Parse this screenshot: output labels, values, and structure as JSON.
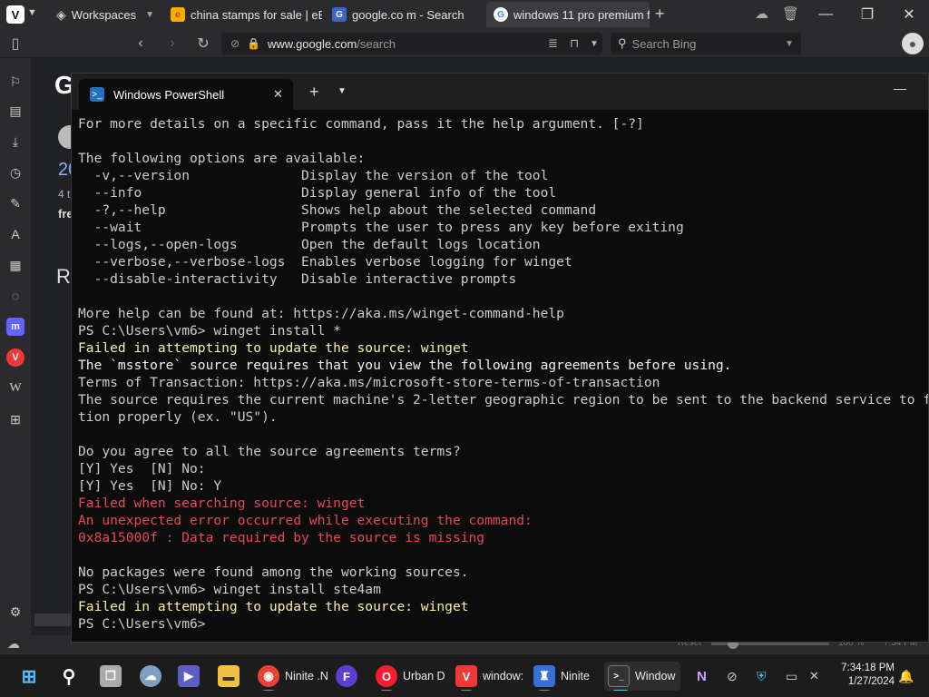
{
  "browser": {
    "workspaces_label": "Workspaces",
    "tabs": [
      {
        "label": "china stamps for sale | eBay"
      },
      {
        "label": "google.co m - Search"
      },
      {
        "label": "windows 11 pro premium fr"
      }
    ],
    "address": {
      "url_domain": "www.google.com",
      "url_path": "/search"
    },
    "search": {
      "placeholder": "Search Bing"
    }
  },
  "page_background": {
    "logo_letter": "G",
    "fragments": [
      "20",
      "4 t",
      "fre",
      "R"
    ]
  },
  "status_strip": {
    "reset_label": "Reset",
    "zoom": "100 %",
    "time": "7:34 PM"
  },
  "powershell": {
    "tab_title": "Windows PowerShell",
    "lines": [
      {
        "t": "For more details on a specific command, pass it the help argument. [-?]",
        "c": "w"
      },
      {
        "t": "",
        "c": "w"
      },
      {
        "t": "The following options are available:",
        "c": "w"
      },
      {
        "t": "  -v,--version              Display the version of the tool",
        "c": "w"
      },
      {
        "t": "  --info                    Display general info of the tool",
        "c": "w"
      },
      {
        "t": "  -?,--help                 Shows help about the selected command",
        "c": "w"
      },
      {
        "t": "  --wait                    Prompts the user to press any key before exiting",
        "c": "w"
      },
      {
        "t": "  --logs,--open-logs        Open the default logs location",
        "c": "w"
      },
      {
        "t": "  --verbose,--verbose-logs  Enables verbose logging for winget",
        "c": "w"
      },
      {
        "t": "  --disable-interactivity   Disable interactive prompts",
        "c": "w"
      },
      {
        "t": "",
        "c": "w"
      },
      {
        "t": "More help can be found at: https://aka.ms/winget-command-help",
        "c": "w"
      },
      {
        "t": "PS C:\\Users\\vm6> winget install *",
        "c": "w"
      },
      {
        "t": "Failed in attempting to update the source: winget",
        "c": "y"
      },
      {
        "t": "The `msstore` source requires that you view the following agreements before using.",
        "c": "hw"
      },
      {
        "t": "Terms of Transaction: https://aka.ms/microsoft-store-terms-of-transaction",
        "c": "w"
      },
      {
        "t": "The source requires the current machine's 2-letter geographic region to be sent to the backend service to func",
        "c": "w"
      },
      {
        "t": "tion properly (ex. \"US\").",
        "c": "w"
      },
      {
        "t": "",
        "c": "w"
      },
      {
        "t": "Do you agree to all the source agreements terms?",
        "c": "w"
      },
      {
        "t": "[Y] Yes  [N] No:",
        "c": "w"
      },
      {
        "t": "[Y] Yes  [N] No: Y",
        "c": "w"
      },
      {
        "t": "Failed when searching source: winget",
        "c": "r"
      },
      {
        "t": "An unexpected error occurred while executing the command:",
        "c": "r"
      },
      {
        "t": "0x8a15000f : Data required by the source is missing",
        "c": "r"
      },
      {
        "t": "",
        "c": "w"
      },
      {
        "t": "No packages were found among the working sources.",
        "c": "w"
      },
      {
        "t": "PS C:\\Users\\vm6> winget install ste4am",
        "c": "w"
      },
      {
        "t": "Failed in attempting to update the source: winget",
        "c": "y"
      },
      {
        "t": "PS C:\\Users\\vm6>",
        "c": "w"
      }
    ]
  },
  "taskbar": {
    "apps": [
      {
        "label": "Ninite .N"
      },
      {
        "label": "Urban D"
      },
      {
        "label": "window:"
      },
      {
        "label": "Ninite"
      },
      {
        "label": "Window"
      }
    ],
    "clock_time": "7:34:18 PM",
    "clock_date": "1/27/2024"
  },
  "colors": {
    "term_bg": "#0c0c0c",
    "term_text": "#cccccc",
    "warning": "#f9f1a5",
    "error": "#e74856",
    "vivaldi": "#ef3939"
  }
}
